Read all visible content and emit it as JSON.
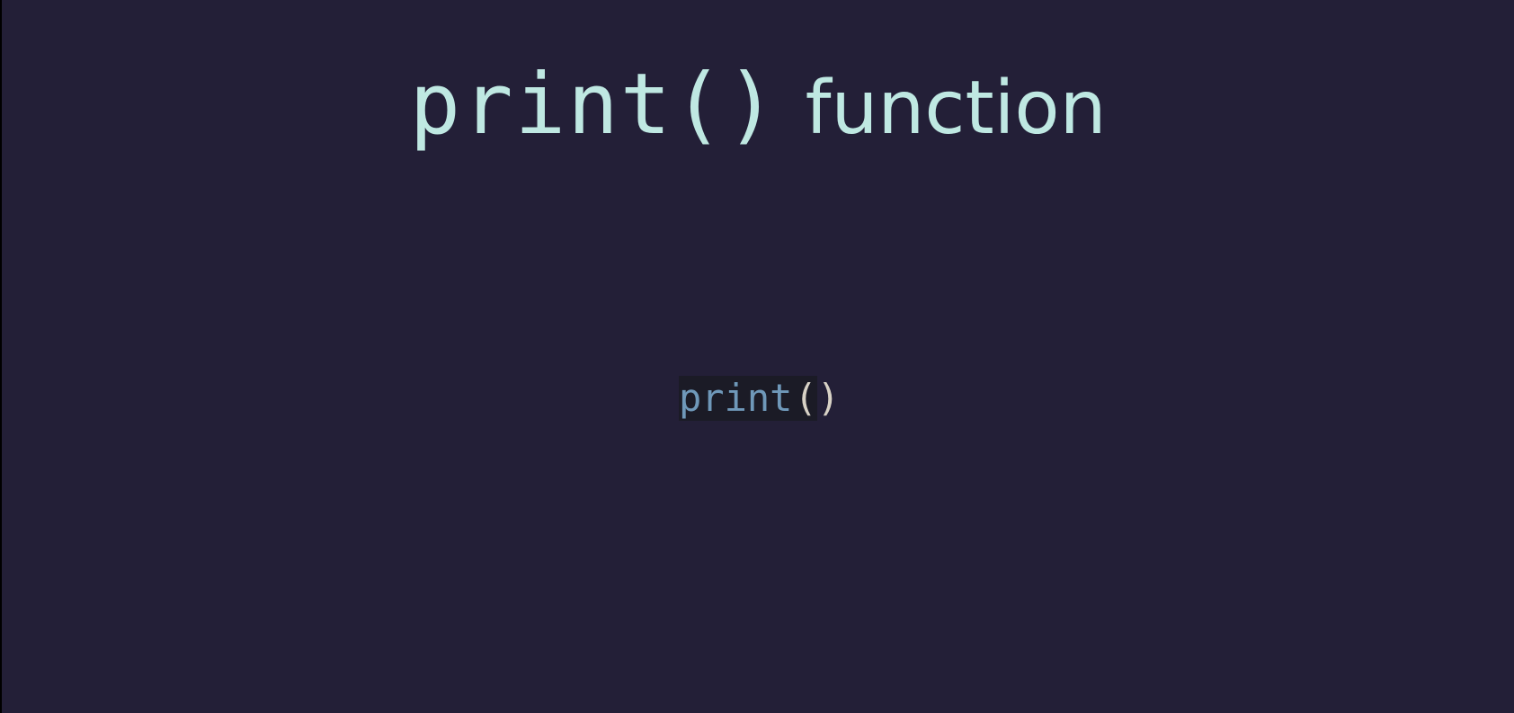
{
  "slide": {
    "title": {
      "code": "print()",
      "word": "function"
    },
    "code": {
      "function_name": "print",
      "open_paren": "(",
      "close_paren": ")"
    }
  },
  "colors": {
    "background": "#231f37",
    "title_text": "#bfe8e2",
    "code_function": "#6f98b9",
    "code_punctuation": "#d8d2c6",
    "code_highlight": "#1b1b26"
  }
}
